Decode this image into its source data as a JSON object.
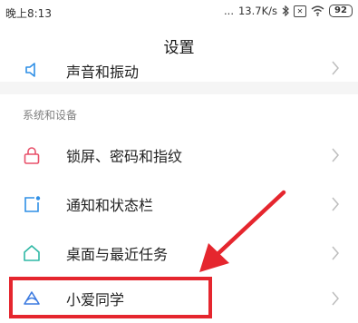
{
  "status_bar": {
    "time": "晚上8:13",
    "signal_dots": "...",
    "network_speed": "13.7K/s",
    "bluetooth_icon": "bluetooth-icon",
    "sim_icon": "sim-x-icon",
    "wifi_icon": "wifi-icon",
    "battery": "92"
  },
  "header": {
    "title": "设置"
  },
  "partial_item": {
    "label": "声音和振动",
    "icon": "speaker-icon"
  },
  "section": {
    "header": "系统和设备",
    "items": [
      {
        "label": "锁屏、密码和指纹",
        "icon": "lock-icon",
        "icon_color": "#e8506a"
      },
      {
        "label": "通知和状态栏",
        "icon": "notification-icon",
        "icon_color": "#2f8fe6"
      },
      {
        "label": "桌面与最近任务",
        "icon": "home-icon",
        "icon_color": "#2fb8a5"
      },
      {
        "label": "小爱同学",
        "icon": "xiaoai-icon",
        "icon_color": "#3d7be0"
      }
    ]
  },
  "annotation": {
    "highlight_color": "#e5262e",
    "arrow_color": "#e5262e"
  }
}
